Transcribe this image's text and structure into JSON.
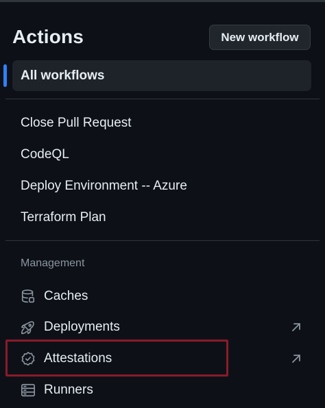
{
  "header": {
    "title": "Actions",
    "new_workflow_label": "New workflow"
  },
  "nav": {
    "all_workflows_label": "All workflows"
  },
  "workflows": [
    {
      "label": "Close Pull Request"
    },
    {
      "label": "CodeQL"
    },
    {
      "label": "Deploy Environment -- Azure"
    },
    {
      "label": "Terraform Plan"
    }
  ],
  "management": {
    "heading": "Management",
    "items": [
      {
        "label": "Caches",
        "icon": "database-icon",
        "external": false
      },
      {
        "label": "Deployments",
        "icon": "rocket-icon",
        "external": true
      },
      {
        "label": "Attestations",
        "icon": "verified-icon",
        "external": true,
        "highlighted": true
      },
      {
        "label": "Runners",
        "icon": "server-icon",
        "external": false
      }
    ]
  },
  "colors": {
    "background": "#0d1117",
    "accent": "#2f81f7",
    "highlight": "#8b1a2b",
    "muted_text": "#8b949e"
  }
}
